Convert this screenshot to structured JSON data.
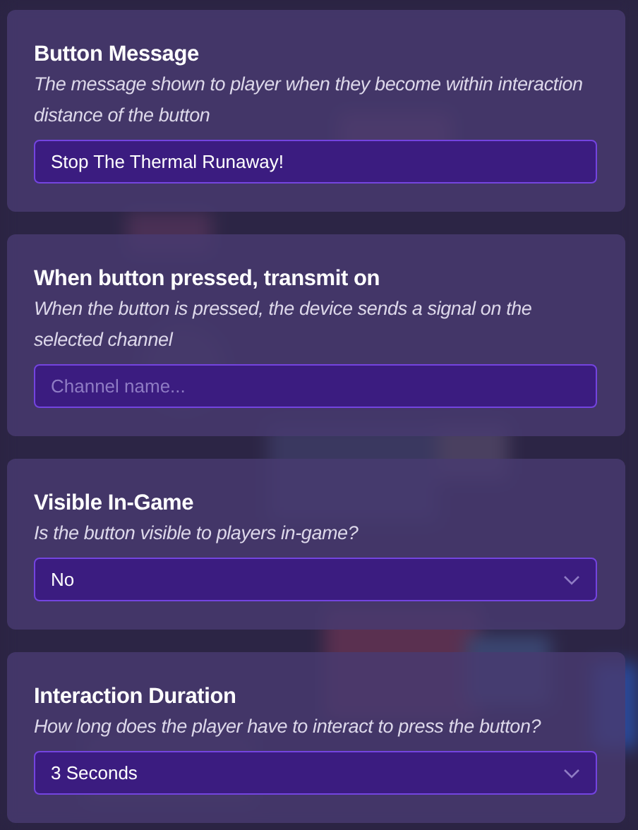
{
  "sections": [
    {
      "kind": "text",
      "title": "Button Message",
      "description": "The message shown to player when they become within interaction distance of the button",
      "value": "Stop The Thermal Runaway!"
    },
    {
      "kind": "text",
      "title": "When button pressed, transmit on",
      "description": "When the button is pressed, the device sends a signal on the selected channel",
      "placeholder": "Channel name..."
    },
    {
      "kind": "dropdown",
      "title": "Visible In-Game",
      "description": "Is the button visible to players in-game?",
      "value": "No"
    },
    {
      "kind": "dropdown",
      "title": "Interaction Duration",
      "description": "How long does the player have to interact to press the button?",
      "value": "3 Seconds"
    }
  ]
}
